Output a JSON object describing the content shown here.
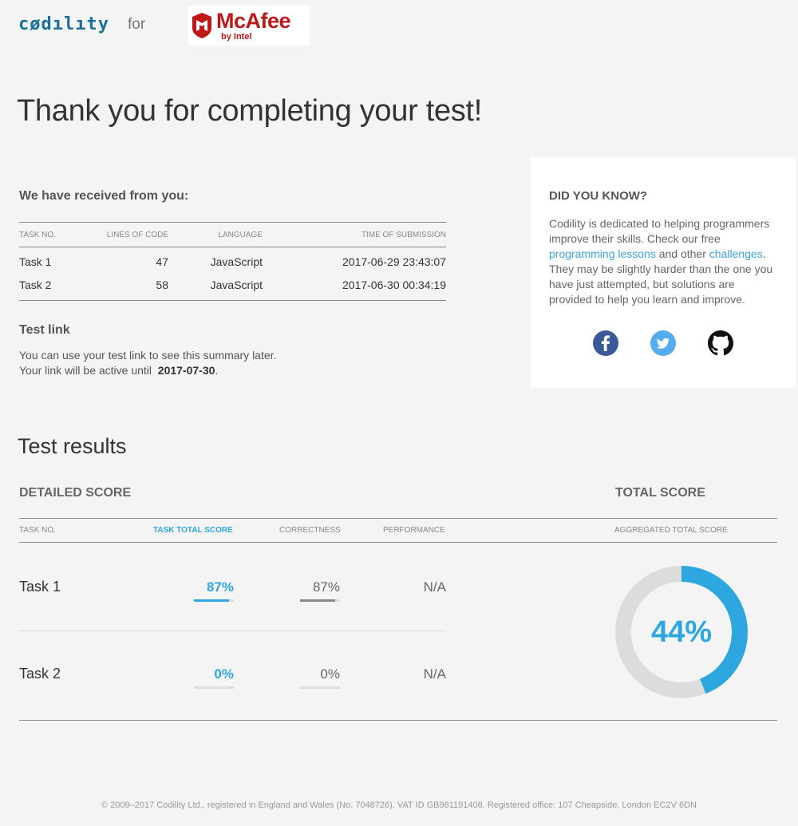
{
  "header": {
    "codility_logo": "cødılıty",
    "for_text": "for",
    "partner_brand": "McAfee",
    "partner_sub": "by Intel"
  },
  "main_title": "Thank you for completing your test!",
  "received": {
    "heading": "We have received from you:",
    "columns": [
      "TASK NO.",
      "LINES OF CODE",
      "LANGUAGE",
      "TIME OF SUBMISSION"
    ],
    "rows": [
      {
        "task": "Task 1",
        "lines": "47",
        "language": "JavaScript",
        "time": "2017-06-29 23:43:07"
      },
      {
        "task": "Task 2",
        "lines": "58",
        "language": "JavaScript",
        "time": "2017-06-30 00:34:19"
      }
    ]
  },
  "test_link": {
    "title": "Test link",
    "line1": "You can use your test link to see this summary later.",
    "line2_prefix": "Your link will be active until",
    "active_until": "2017-07-30",
    "line2_suffix": "."
  },
  "did_you_know": {
    "title": "DID YOU KNOW?",
    "text1": "Codility is dedicated to helping programmers improve their skills. Check our free ",
    "link1": "programming lessons",
    "text2": " and other ",
    "link2": "challenges",
    "text3": ". They may be slightly harder than the one you have just attempted, but solutions are provided to help you learn and improve.",
    "socials": [
      "facebook-icon",
      "twitter-icon",
      "github-icon"
    ]
  },
  "results": {
    "title": "Test results",
    "detailed_title": "DETAILED SCORE",
    "total_title": "TOTAL SCORE",
    "columns": {
      "task": "TASK NO.",
      "total": "TASK TOTAL SCORE",
      "correctness": "CORRECTNESS",
      "performance": "PERFORMANCE",
      "aggregated": "AGGREGATED TOTAL SCORE"
    },
    "tasks": [
      {
        "name": "Task 1",
        "total": "87%",
        "total_pct": 87,
        "correctness": "87%",
        "correctness_pct": 87,
        "performance": "N/A"
      },
      {
        "name": "Task 2",
        "total": "0%",
        "total_pct": 0,
        "correctness": "0%",
        "correctness_pct": 0,
        "performance": "N/A"
      }
    ],
    "aggregated_score": "44%",
    "aggregated_pct": 44
  },
  "colors": {
    "accent": "#2ea7e0",
    "brand_red": "#c01818",
    "codility_blue": "#1a6f9b"
  },
  "footer": "© 2009–2017 Codility Ltd., registered in England and Wales (No. 7048726). VAT ID GB981191408. Registered office: 107 Cheapside, London EC2V 6DN"
}
